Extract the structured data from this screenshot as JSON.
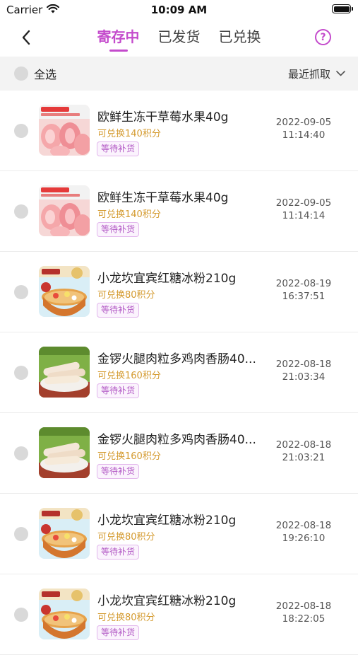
{
  "status": {
    "carrier": "Carrier",
    "time": "10:09 AM",
    "battery_level": 1.0
  },
  "nav": {
    "tabs": [
      {
        "label": "寄存中",
        "active": true
      },
      {
        "label": "已发货",
        "active": false
      },
      {
        "label": "已兑换",
        "active": false
      }
    ],
    "help": "?"
  },
  "filter": {
    "select_all": "全选",
    "sort_label": "最近抓取"
  },
  "items": [
    {
      "title": "欧鲜生冻干草莓水果40g",
      "points": "可兑换140积分",
      "tag": "等待补货",
      "date": "2022-09-05",
      "time": "11:14:40",
      "image": "strawberry-product-image"
    },
    {
      "title": "欧鲜生冻干草莓水果40g",
      "points": "可兑换140积分",
      "tag": "等待补货",
      "date": "2022-09-05",
      "time": "11:14:14",
      "image": "strawberry-product-image"
    },
    {
      "title": "小龙坎宜宾红糖冰粉210g",
      "points": "可兑换80积分",
      "tag": "等待补货",
      "date": "2022-08-19",
      "time": "16:37:51",
      "image": "ice-jelly-product-image"
    },
    {
      "title": "金锣火腿肉粒多鸡肉香肠40...",
      "points": "可兑换160积分",
      "tag": "等待补货",
      "date": "2022-08-18",
      "time": "21:03:34",
      "image": "sausage-product-image"
    },
    {
      "title": "金锣火腿肉粒多鸡肉香肠40...",
      "points": "可兑换160积分",
      "tag": "等待补货",
      "date": "2022-08-18",
      "time": "21:03:21",
      "image": "sausage-product-image"
    },
    {
      "title": "小龙坎宜宾红糖冰粉210g",
      "points": "可兑换80积分",
      "tag": "等待补货",
      "date": "2022-08-18",
      "time": "19:26:10",
      "image": "ice-jelly-product-image"
    },
    {
      "title": "小龙坎宜宾红糖冰粉210g",
      "points": "可兑换80积分",
      "tag": "等待补货",
      "date": "2022-08-18",
      "time": "18:22:05",
      "image": "ice-jelly-product-image"
    }
  ]
}
